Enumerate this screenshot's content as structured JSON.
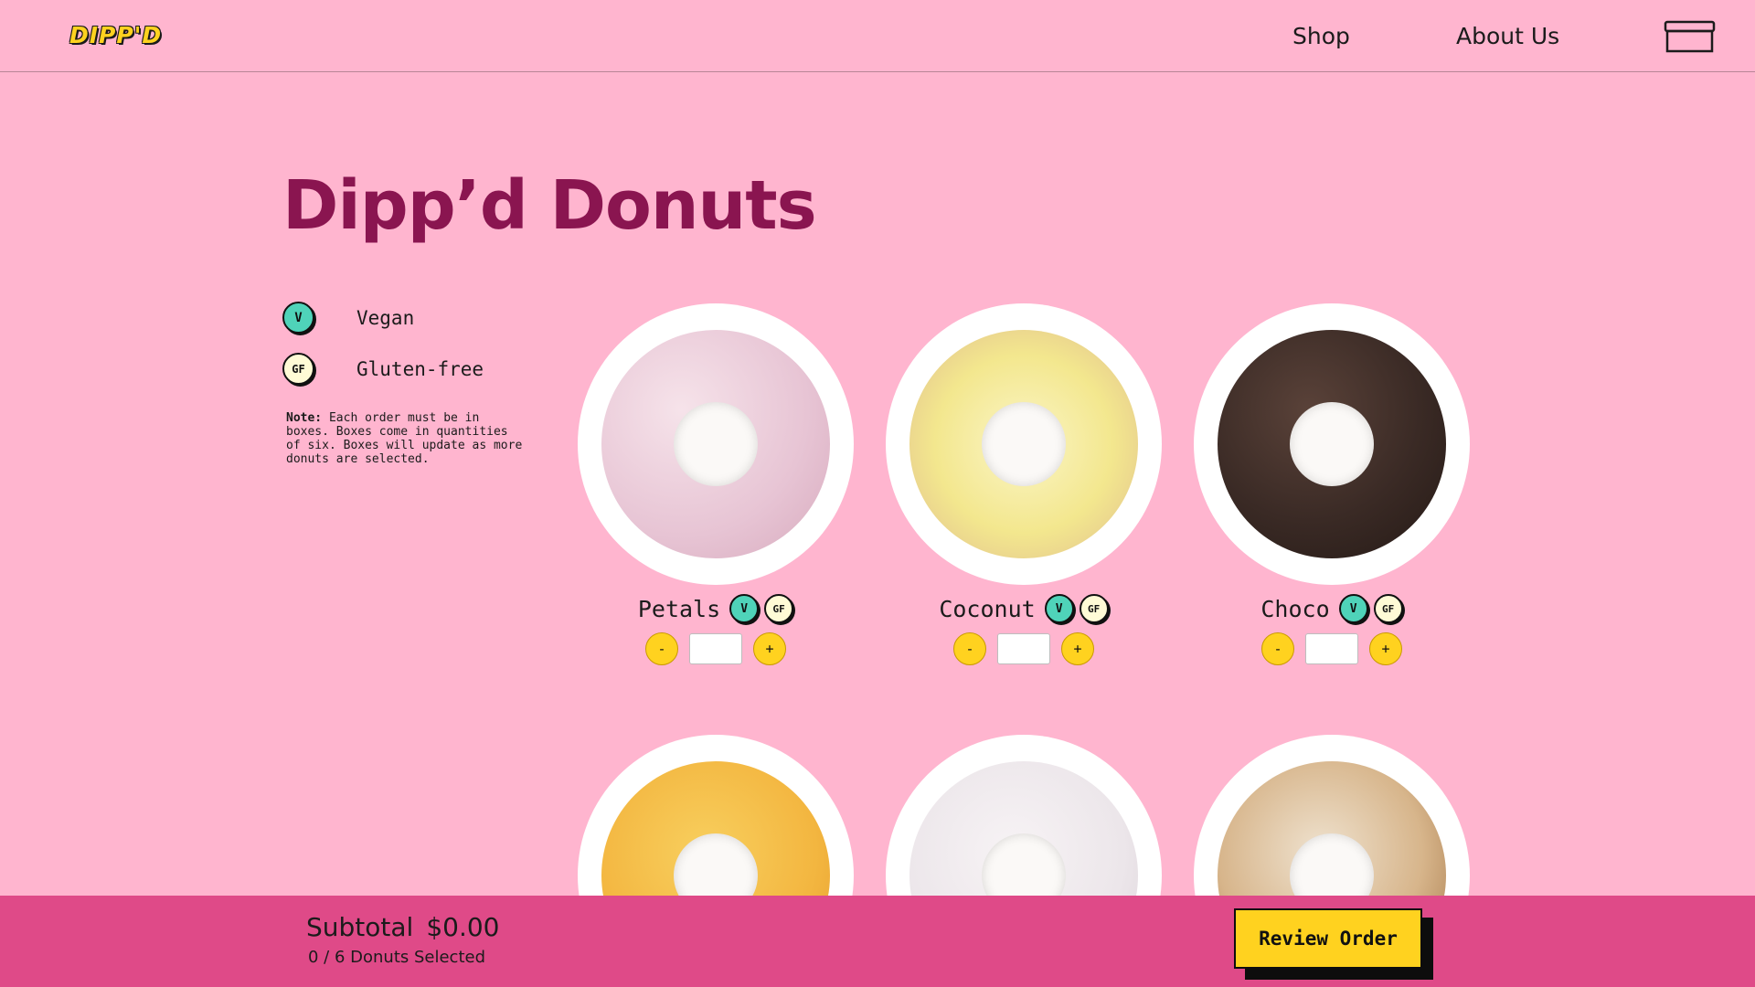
{
  "header": {
    "logo": "DIPP'D",
    "nav": {
      "shop": "Shop",
      "about": "About Us"
    },
    "cart_icon": "cart-box-icon"
  },
  "page_title": "Dipp’d Donuts",
  "legend": {
    "vegan": {
      "badge": "V",
      "label": "Vegan"
    },
    "gluten_free": {
      "badge": "GF",
      "label": "Gluten-free"
    }
  },
  "note": {
    "prefix": "Note:",
    "text": " Each order must be in boxes. Boxes come in quantities of six. Boxes will update as more donuts are selected."
  },
  "products": [
    {
      "name": "Petals",
      "v": "V",
      "gf": "GF",
      "qty_minus": "-",
      "qty_plus": "+",
      "qty_value": "",
      "glaze": "#e9cdd9"
    },
    {
      "name": "Coconut",
      "v": "V",
      "gf": "GF",
      "qty_minus": "-",
      "qty_plus": "+",
      "qty_value": "",
      "glaze": "#f1e7a0"
    },
    {
      "name": "Choco",
      "v": "V",
      "gf": "GF",
      "qty_minus": "-",
      "qty_plus": "+",
      "qty_value": "",
      "glaze": "#3a2a25"
    },
    {
      "glaze": "#f3b640"
    },
    {
      "glaze": "#ece6ea"
    },
    {
      "glaze": "#d7b58b"
    }
  ],
  "footer": {
    "subtotal_label": "Subtotal",
    "subtotal_value": "$0.00",
    "count_text": "0 / 6 Donuts Selected",
    "review_button": "Review Order"
  },
  "colors": {
    "background": "#ffb5cf",
    "title": "#8a1550",
    "footer": "#df4a88",
    "accent_yellow": "#ffd21f",
    "vegan_badge": "#4fd3b9"
  }
}
